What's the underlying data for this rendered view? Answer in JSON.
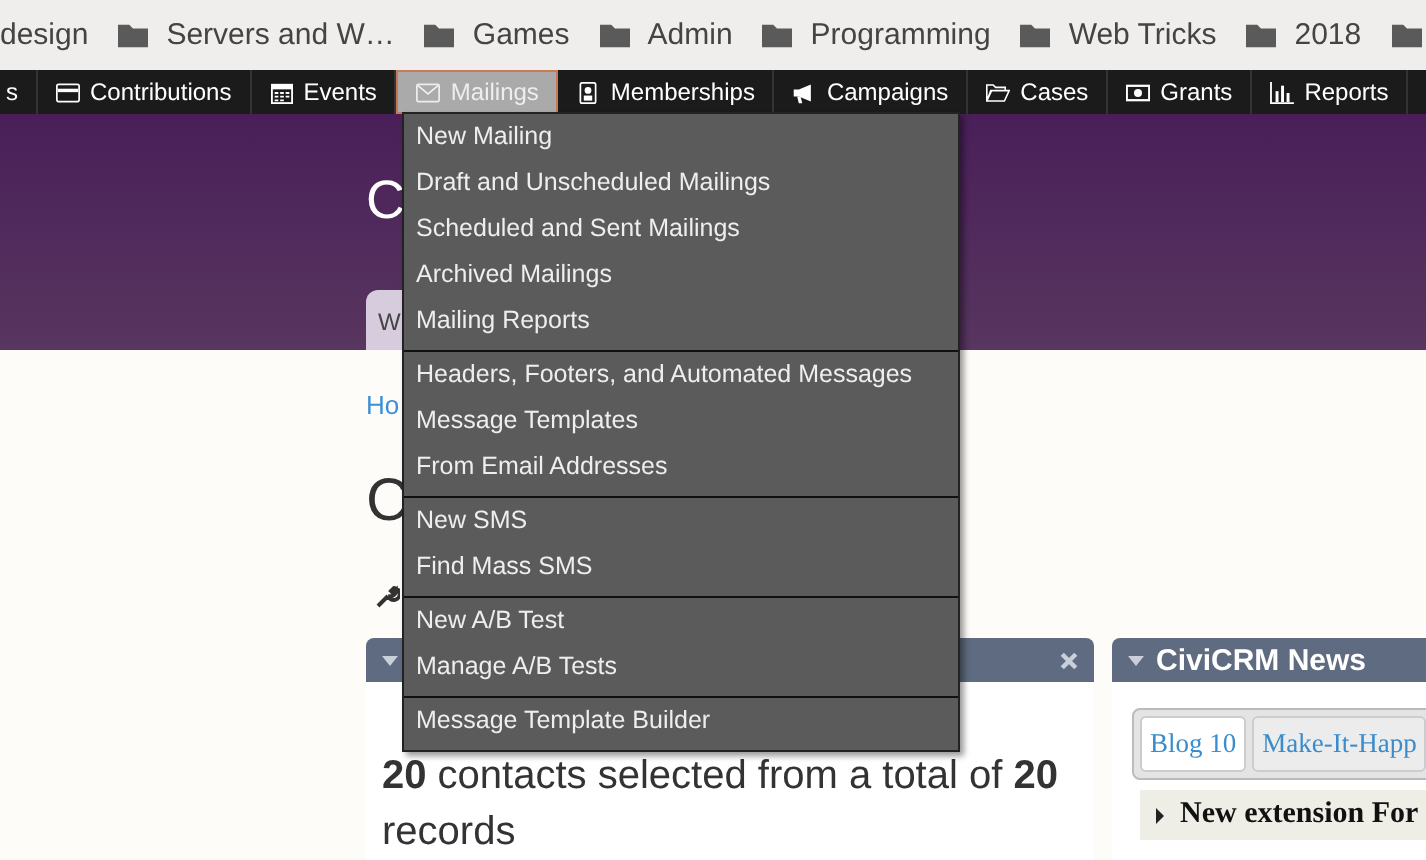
{
  "bookmarks": [
    {
      "label": "design",
      "kind": "plain"
    },
    {
      "label": "Servers and W…",
      "kind": "folder"
    },
    {
      "label": "Games",
      "kind": "folder"
    },
    {
      "label": "Admin",
      "kind": "folder"
    },
    {
      "label": "Programming",
      "kind": "folder"
    },
    {
      "label": "Web Tricks",
      "kind": "folder"
    },
    {
      "label": "2018",
      "kind": "folder"
    },
    {
      "kind": "folder"
    }
  ],
  "menubar": [
    {
      "label": "s",
      "selected": false
    },
    {
      "label": "Contributions",
      "selected": false
    },
    {
      "label": "Events",
      "selected": false
    },
    {
      "label": "Mailings",
      "selected": true
    },
    {
      "label": "Memberships",
      "selected": false
    },
    {
      "label": "Campaigns",
      "selected": false
    },
    {
      "label": "Cases",
      "selected": false
    },
    {
      "label": "Grants",
      "selected": false
    },
    {
      "label": "Reports",
      "selected": false
    }
  ],
  "dropdown": [
    [
      "New Mailing",
      "Draft and Unscheduled Mailings",
      "Scheduled and Sent Mailings",
      "Archived Mailings",
      "Mailing Reports"
    ],
    [
      "Headers, Footers, and Automated Messages",
      "Message Templates",
      "From Email Addresses"
    ],
    [
      "New SMS",
      "Find Mass SMS"
    ],
    [
      "New A/B Test",
      "Manage A/B Tests"
    ],
    [
      "Message Template Builder"
    ]
  ],
  "header": {
    "title": "C",
    "tab": "W"
  },
  "breadcrumb": "Ho",
  "page_title": "C",
  "dashlets": [
    {
      "summary": "**20** contacts selected from a total of **20** records"
    },
    {
      "title": "CiviCRM News",
      "tabs": [
        {
          "label": "Blog 10",
          "selected": true
        },
        {
          "label": "Make-It-Happ",
          "selected": false
        }
      ],
      "entry": "New extension For"
    }
  ]
}
